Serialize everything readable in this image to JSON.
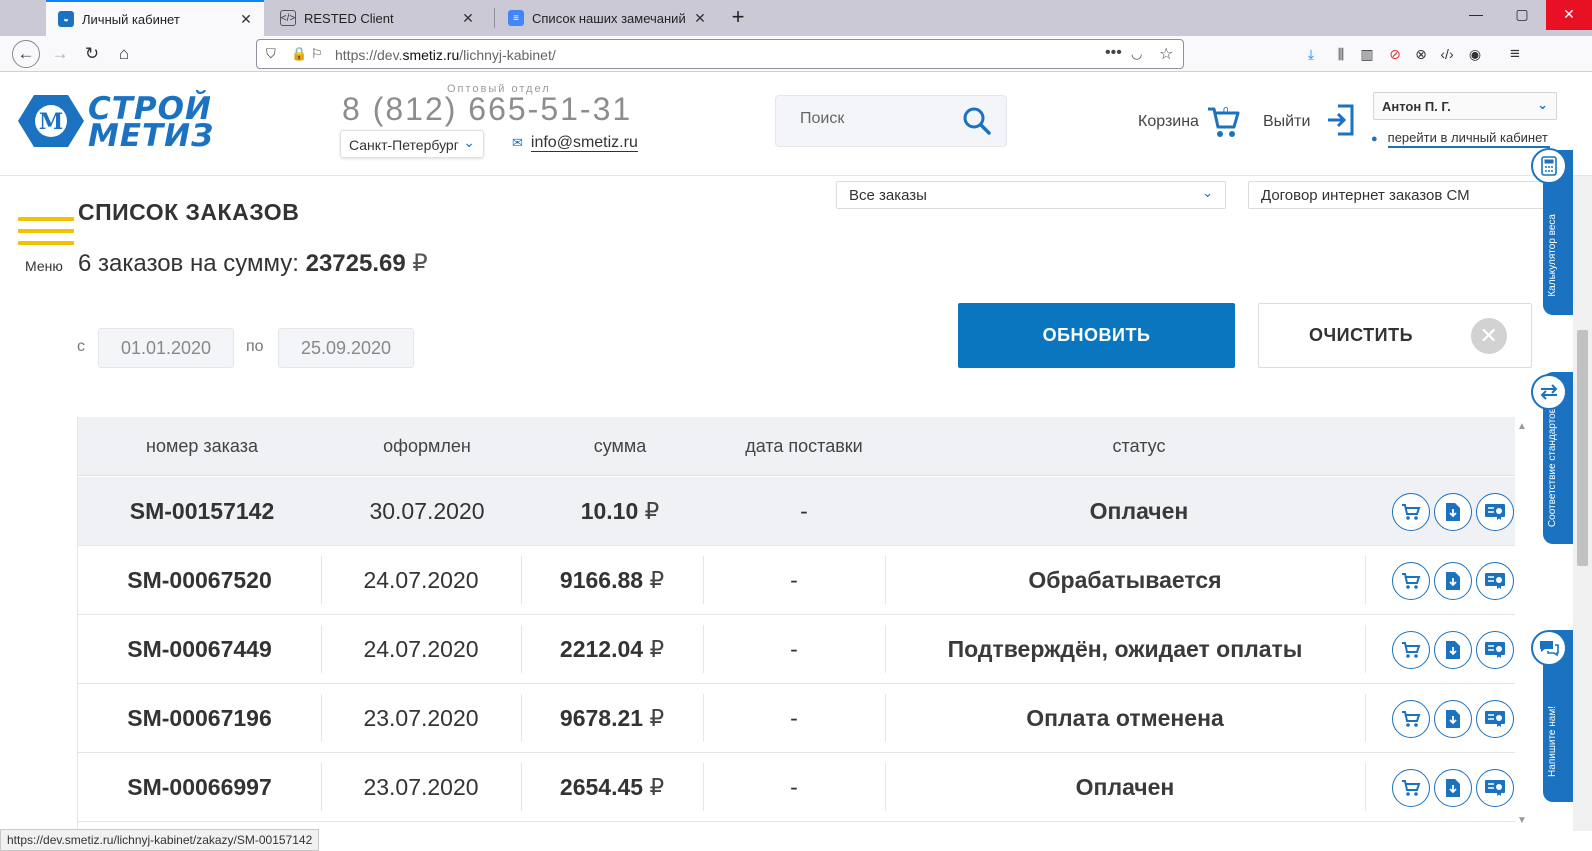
{
  "browser": {
    "tabs": [
      {
        "label": "Личный кабинет",
        "active": true
      },
      {
        "label": "RESTED Client",
        "active": false
      },
      {
        "label": "Список наших замечаний - G",
        "active": false
      }
    ],
    "url_prefix": "https://dev.",
    "url_domain": "smetiz.ru",
    "url_path": "/lichnyj-kabinet/",
    "status_url": "https://dev.smetiz.ru/lichnyj-kabinet/zakazy/SM-00157142"
  },
  "header": {
    "logo_line1": "СТРОЙ",
    "logo_line2": "МЕТИЗ",
    "department": "Оптовый отдел",
    "phone": "8 (812) 665-51-31",
    "city": "Санкт-Петербург",
    "email": "info@smetiz.ru",
    "search_placeholder": "Поиск",
    "cart_label": "Корзина",
    "cart_count": "0",
    "logout_label": "Выйти",
    "user_name": "Антон П. Г.",
    "cabinet_link": "перейти в личный кабинет"
  },
  "menu": {
    "label": "Меню"
  },
  "orders": {
    "title": "СПИСОК ЗАКАЗОВ",
    "summary_prefix": "6 заказов на сумму:",
    "summary_total": "23725.69",
    "currency": "₽",
    "filter_status": "Все заказы",
    "filter_contract": "Договор интернет заказов СМ",
    "date_from_label": "с",
    "date_from": "01.01.2020",
    "date_to_label": "по",
    "date_to": "25.09.2020",
    "refresh_label": "ОБНОВИТЬ",
    "clear_label": "ОЧИСТИТЬ",
    "columns": [
      "номер заказа",
      "оформлен",
      "сумма",
      "дата поставки",
      "статус"
    ],
    "rows": [
      {
        "number": "SM-00157142",
        "date": "30.07.2020",
        "sum": "10.10",
        "delivery": "-",
        "status": "Оплачен"
      },
      {
        "number": "SM-00067520",
        "date": "24.07.2020",
        "sum": "9166.88",
        "delivery": "-",
        "status": "Обрабатывается"
      },
      {
        "number": "SM-00067449",
        "date": "24.07.2020",
        "sum": "2212.04",
        "delivery": "-",
        "status": "Подтверждён, ожидает оплаты"
      },
      {
        "number": "SM-00067196",
        "date": "23.07.2020",
        "sum": "9678.21",
        "delivery": "-",
        "status": "Оплата отменена"
      },
      {
        "number": "SM-00066997",
        "date": "23.07.2020",
        "sum": "2654.45",
        "delivery": "-",
        "status": "Оплачен"
      }
    ]
  },
  "side": {
    "calc_label": "Калькулятор веса",
    "standards_label": "Соответствие стандартов",
    "write_label": "Напишите нам!"
  },
  "colors": {
    "brand_blue": "#0b76c0",
    "menu_yellow": "#f2c200"
  }
}
